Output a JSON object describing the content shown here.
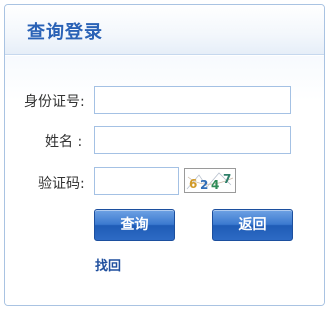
{
  "panel": {
    "title": "查询登录"
  },
  "form": {
    "id_label": "身份证号:",
    "id_value": "",
    "name_label": "姓名 :",
    "name_value": "",
    "captcha_label": "验证码:",
    "captcha_value": "",
    "captcha_text": "6247"
  },
  "buttons": {
    "query": "查询",
    "back": "返回"
  },
  "links": {
    "retrieve": "找回"
  }
}
